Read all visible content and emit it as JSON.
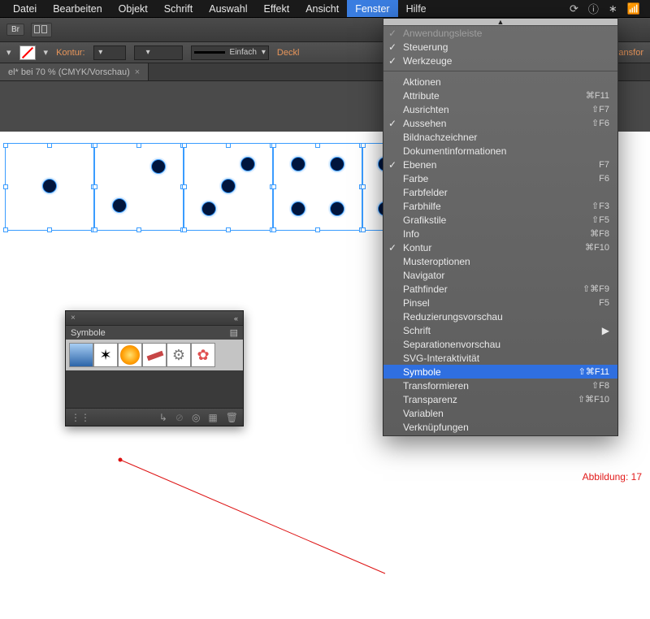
{
  "menubar": {
    "items": [
      "Datei",
      "Bearbeiten",
      "Objekt",
      "Schrift",
      "Auswahl",
      "Effekt",
      "Ansicht",
      "Fenster",
      "Hilfe"
    ],
    "open_index": 7,
    "sysicons": [
      "sync-icon",
      "info-icon",
      "bluetooth-icon",
      "wifi-icon"
    ]
  },
  "appbar": {
    "btn1": "Br"
  },
  "optionsbar": {
    "kontur_label": "Kontur:",
    "stroke_style": "Einfach",
    "deck": "Deckl",
    "far_right": "ransfor"
  },
  "document_tab": {
    "title": "el* bei 70 % (CMYK/Vorschau)"
  },
  "sym_panel": {
    "title": "Symbole",
    "footer_icons": [
      "list-icon",
      "arrow-icon",
      "link-icon",
      "target-icon",
      "new-icon",
      "trash-icon"
    ]
  },
  "dropdown": {
    "rows": [
      {
        "label": "Anwendungsleiste",
        "checked": true,
        "dim": true
      },
      {
        "label": "Steuerung",
        "checked": true
      },
      {
        "label": "Werkzeuge",
        "checked": true
      },
      {
        "sep": true
      },
      {
        "label": "Aktionen"
      },
      {
        "label": "Attribute",
        "shortcut": "⌘F11"
      },
      {
        "label": "Ausrichten",
        "shortcut": "⇧F7"
      },
      {
        "label": "Aussehen",
        "checked": true,
        "shortcut": "⇧F6"
      },
      {
        "label": "Bildnachzeichner"
      },
      {
        "label": "Dokumentinformationen"
      },
      {
        "label": "Ebenen",
        "checked": true,
        "shortcut": "F7"
      },
      {
        "label": "Farbe",
        "shortcut": "F6"
      },
      {
        "label": "Farbfelder"
      },
      {
        "label": "Farbhilfe",
        "shortcut": "⇧F3"
      },
      {
        "label": "Grafikstile",
        "shortcut": "⇧F5"
      },
      {
        "label": "Info",
        "shortcut": "⌘F8"
      },
      {
        "label": "Kontur",
        "checked": true,
        "shortcut": "⌘F10"
      },
      {
        "label": "Musteroptionen"
      },
      {
        "label": "Navigator"
      },
      {
        "label": "Pathfinder",
        "shortcut": "⇧⌘F9"
      },
      {
        "label": "Pinsel",
        "shortcut": "F5"
      },
      {
        "label": "Reduzierungsvorschau"
      },
      {
        "label": "Schrift",
        "submenu": true
      },
      {
        "label": "Separationenvorschau"
      },
      {
        "label": "SVG-Interaktivität"
      },
      {
        "label": "Symbole",
        "shortcut": "⇧⌘F11",
        "selected": true
      },
      {
        "label": "Transformieren",
        "shortcut": "⇧F8"
      },
      {
        "label": "Transparenz",
        "shortcut": "⇧⌘F10"
      },
      {
        "label": "Variablen"
      },
      {
        "label": "Verknüpfungen"
      }
    ]
  },
  "figure_label": "Abbildung: 17",
  "dice": [
    {
      "pips": [
        [
          50,
          50
        ]
      ]
    },
    {
      "pips": [
        [
          72,
          28
        ],
        [
          28,
          72
        ]
      ]
    },
    {
      "pips": [
        [
          72,
          25
        ],
        [
          50,
          50
        ],
        [
          28,
          75
        ]
      ]
    },
    {
      "pips": [
        [
          28,
          25
        ],
        [
          72,
          25
        ],
        [
          28,
          75
        ],
        [
          72,
          75
        ]
      ]
    },
    {
      "pips": [
        [
          25,
          25
        ],
        [
          75,
          25
        ],
        [
          50,
          50
        ],
        [
          25,
          75
        ],
        [
          75,
          75
        ]
      ]
    }
  ]
}
